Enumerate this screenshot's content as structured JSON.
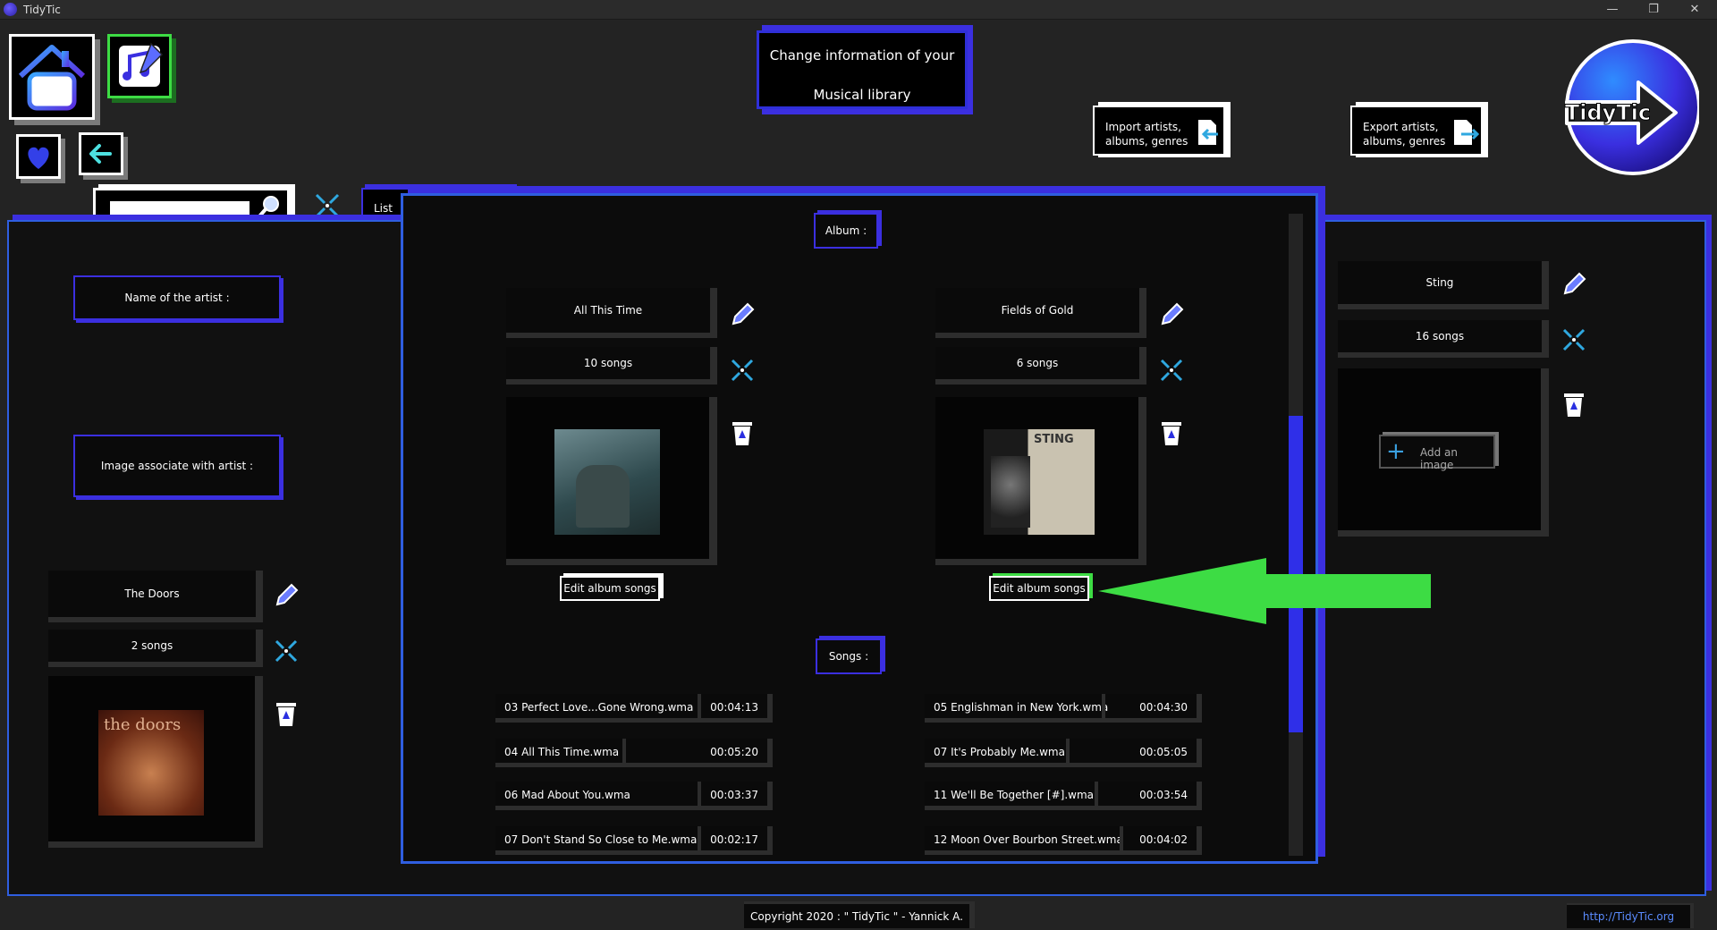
{
  "window": {
    "title": "TidyTic",
    "minimize": "—",
    "restore": "❐",
    "close": "✕"
  },
  "header": {
    "title_line1": "Change information of your",
    "title_line2": "Musical library",
    "import_label_line1": "Import artists,",
    "import_label_line2": "albums, genres",
    "export_label_line1": "Export artists,",
    "export_label_line2": "albums, genres",
    "logo_text": "TidyTic"
  },
  "toolbar": {
    "list_tab": "List"
  },
  "left": {
    "name_label": "Name of the artist :",
    "image_label": "Image associate with artist :",
    "artist_name": "The Doors",
    "artist_songs": "2 songs",
    "cover_text": "the doors"
  },
  "center": {
    "album_header": "Album :",
    "songs_header": "Songs :",
    "albums": [
      {
        "title": "All This Time",
        "songs": "10 songs",
        "edit_label": "Edit album songs"
      },
      {
        "title": "Fields of Gold",
        "songs": "6 songs",
        "edit_label": "Edit album songs",
        "cover_text": "STING"
      }
    ],
    "songs_left": [
      {
        "name": "03 Perfect Love...Gone Wrong.wma",
        "time": "00:04:13"
      },
      {
        "name": "04 All This Time.wma",
        "time": "00:05:20"
      },
      {
        "name": "06 Mad About You.wma",
        "time": "00:03:37"
      },
      {
        "name": "07 Don't Stand So Close to Me.wma",
        "time": "00:02:17"
      }
    ],
    "songs_right": [
      {
        "name": "05 Englishman in New York.wma",
        "time": "00:04:30"
      },
      {
        "name": "07 It's Probably Me.wma",
        "time": "00:05:05"
      },
      {
        "name": "11 We'll Be Together [#].wma",
        "time": "00:03:54"
      },
      {
        "name": "12 Moon Over Bourbon Street.wma",
        "time": "00:04:02"
      }
    ]
  },
  "right": {
    "artist_name": "Sting",
    "artist_songs": "16 songs",
    "add_image_label": "Add an image"
  },
  "footer": {
    "copyright": "Copyright 2020 : \" TidyTic \" - Yannick A.",
    "link": "http://TidyTic.org"
  },
  "colors": {
    "accent": "#3b2fe0",
    "arrow": "#3ddc44",
    "background": "#232323"
  }
}
